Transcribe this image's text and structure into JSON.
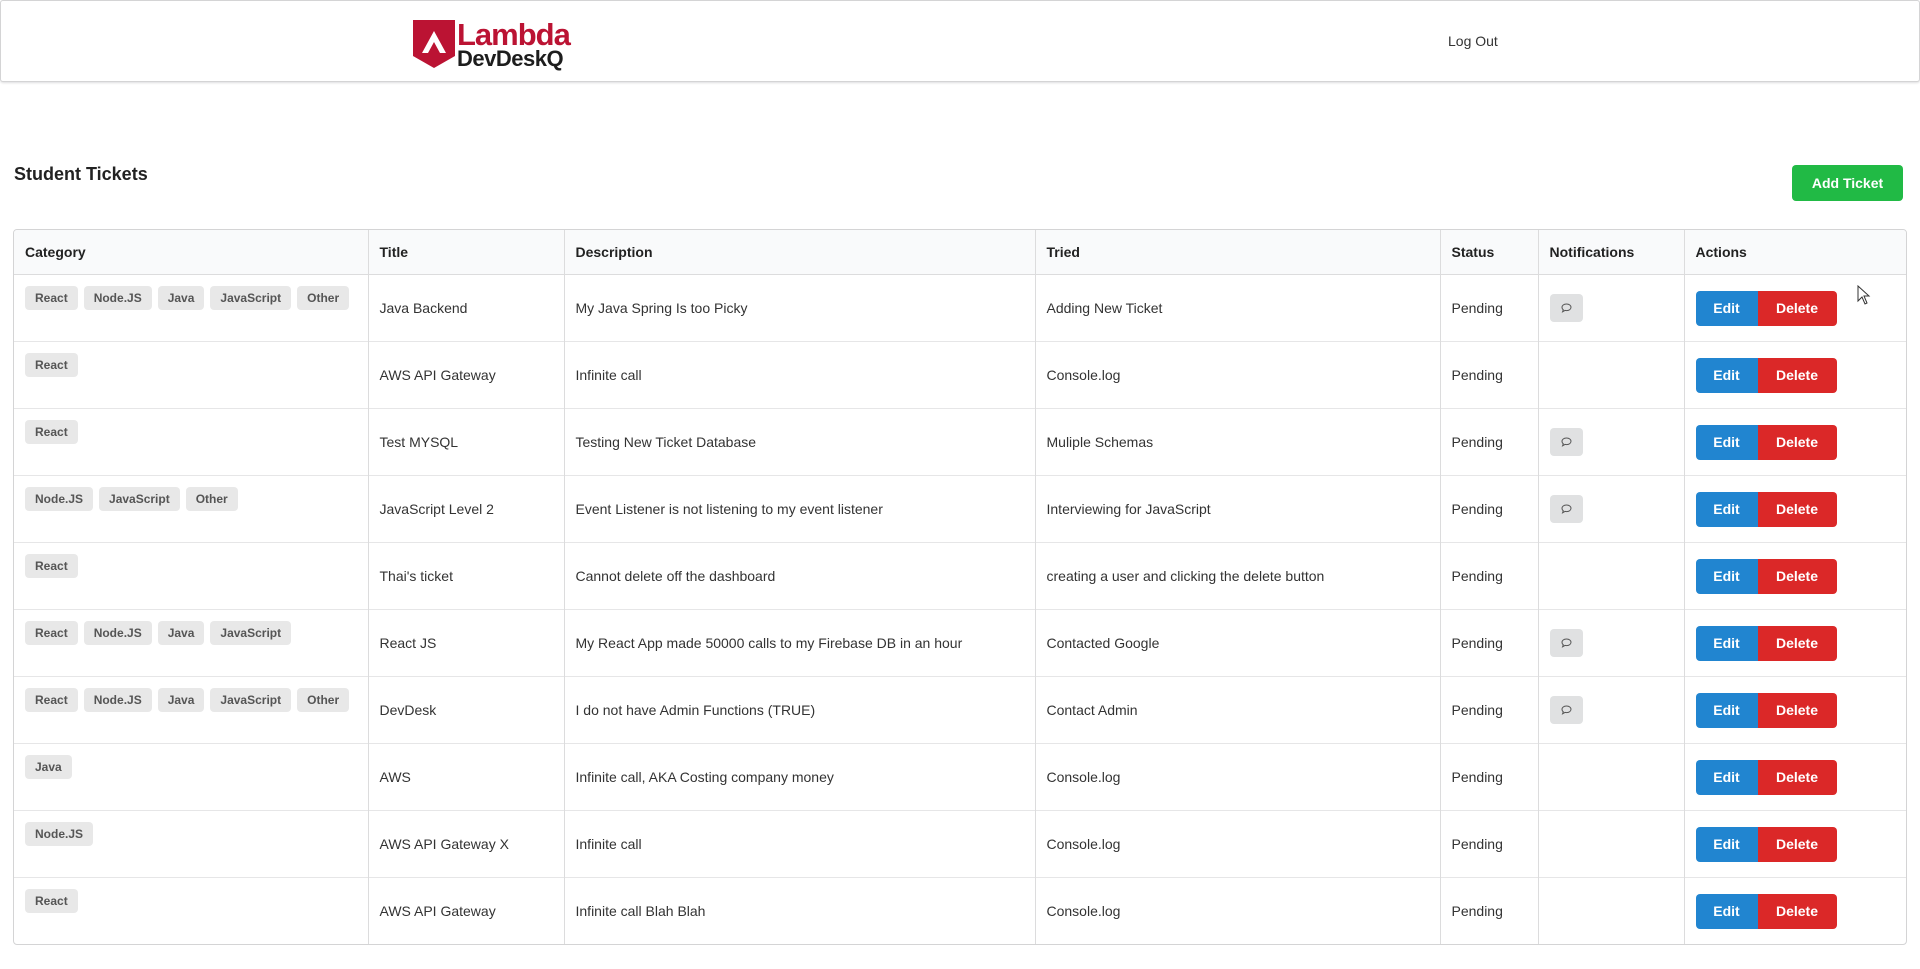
{
  "header": {
    "logo_line1": "Lambda",
    "logo_line2": "DevDeskQ",
    "logout_label": "Log Out"
  },
  "page": {
    "title": "Student Tickets",
    "add_button_label": "Add Ticket"
  },
  "table": {
    "columns": [
      "Category",
      "Title",
      "Description",
      "Tried",
      "Status",
      "Notifications",
      "Actions"
    ],
    "rows": [
      {
        "categories": [
          "React",
          "Node.JS",
          "Java",
          "JavaScript",
          "Other"
        ],
        "title": "Java Backend",
        "description": "My Java Spring Is too Picky",
        "tried": "Adding New Ticket",
        "status": "Pending",
        "has_notification": true
      },
      {
        "categories": [
          "React"
        ],
        "title": "AWS API Gateway",
        "description": "Infinite call",
        "tried": "Console.log",
        "status": "Pending",
        "has_notification": false
      },
      {
        "categories": [
          "React"
        ],
        "title": "Test MYSQL",
        "description": "Testing New Ticket Database",
        "tried": "Muliple Schemas",
        "status": "Pending",
        "has_notification": true
      },
      {
        "categories": [
          "Node.JS",
          "JavaScript",
          "Other"
        ],
        "title": "JavaScript Level 2",
        "description": "Event Listener is not listening to my event listener",
        "tried": "Interviewing for JavaScript",
        "status": "Pending",
        "has_notification": true
      },
      {
        "categories": [
          "React"
        ],
        "title": "Thai's ticket",
        "description": "Cannot delete off the dashboard",
        "tried": "creating a user and clicking the delete button",
        "status": "Pending",
        "has_notification": false
      },
      {
        "categories": [
          "React",
          "Node.JS",
          "Java",
          "JavaScript"
        ],
        "title": "React JS",
        "description": "My React App made 50000 calls to my Firebase DB in an hour",
        "tried": "Contacted Google",
        "status": "Pending",
        "has_notification": true
      },
      {
        "categories": [
          "React",
          "Node.JS",
          "Java",
          "JavaScript",
          "Other"
        ],
        "title": "DevDesk",
        "description": "I do not have Admin Functions (TRUE)",
        "tried": "Contact Admin",
        "status": "Pending",
        "has_notification": true
      },
      {
        "categories": [
          "Java"
        ],
        "title": "AWS",
        "description": "Infinite call, AKA Costing company money",
        "tried": "Console.log",
        "status": "Pending",
        "has_notification": false
      },
      {
        "categories": [
          "Node.JS"
        ],
        "title": "AWS API Gateway X",
        "description": "Infinite call",
        "tried": "Console.log",
        "status": "Pending",
        "has_notification": false
      },
      {
        "categories": [
          "React"
        ],
        "title": "AWS API Gateway",
        "description": "Infinite call Blah Blah",
        "tried": "Console.log",
        "status": "Pending",
        "has_notification": false
      }
    ],
    "edit_label": "Edit",
    "delete_label": "Delete"
  },
  "colors": {
    "brand": "#bb1333",
    "add_button": "#21ba45",
    "edit_button": "#2185d0",
    "delete_button": "#db2828"
  }
}
